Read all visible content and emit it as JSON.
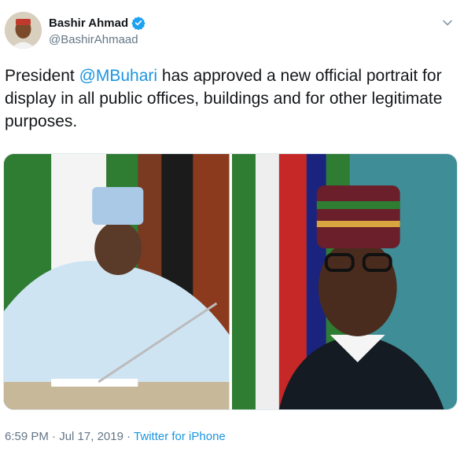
{
  "author": {
    "display_name": "Bashir Ahmad",
    "handle": "@BashirAhmaad",
    "verified": true
  },
  "tweet": {
    "text_before": "President ",
    "mention": "@MBuhari",
    "text_after": " has approved a new official portrait for display in all public offices, buildings and for other legitimate purposes."
  },
  "media": [
    {
      "icon": "photo-signing-document"
    },
    {
      "icon": "photo-official-portrait"
    }
  ],
  "footer": {
    "time": "6:59 PM",
    "separator": "·",
    "date": "Jul 17, 2019",
    "source": "Twitter for iPhone"
  },
  "colors": {
    "accent": "#1b95e0",
    "secondary_text": "#657786",
    "flag_green": "#008751"
  }
}
